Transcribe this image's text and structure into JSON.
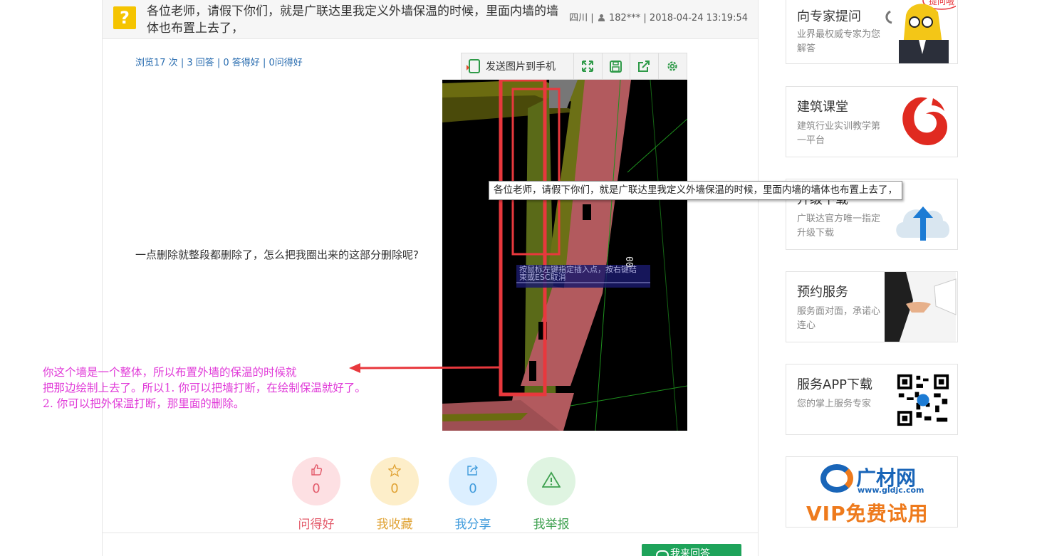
{
  "question": {
    "icon": "?",
    "title": "各位老师，请假下你们，就是广联达里我定义外墙保温的时候，里面内墙的墙体也布置上去了，",
    "region": "四川",
    "user": "182***",
    "time": "2018-04-24 13:19:54",
    "body": "一点删除就整段都删除了，怎么把我圈出来的这部分删除呢?"
  },
  "stats": {
    "views": "浏览17 次",
    "answers": "3 回答",
    "good_answers": "0 答得好",
    "good_questions": "0问得好",
    "sep": " | "
  },
  "image_toolbar": {
    "send_label": "发送图片到手机"
  },
  "cad_overlay": {
    "prompt_line1": "按鼠标左键指定插入点，按右键结",
    "prompt_line2": "束或ESC取消",
    "number": "00"
  },
  "tooltip": "各位老师，请假下你们，就是广联达里我定义外墙保温的时候，里面内墙的墙体也布置上去了，",
  "annotation": {
    "line1": "你这个墙是一个整体，所以布置外墙的保温的时候就",
    "line2": "把那边绘制上去了。所以1. 你可以把墙打断，在绘制保温就好了。",
    "line3": "2. 你可以把外保温打断，那里面的删除。"
  },
  "actions": [
    {
      "label": "问得好",
      "count": "0",
      "icon": "thumb-up-icon"
    },
    {
      "label": "我收藏",
      "count": "0",
      "icon": "star-icon"
    },
    {
      "label": "我分享",
      "count": "0",
      "icon": "share-icon"
    },
    {
      "label": "我举报",
      "count": "",
      "icon": "warning-icon"
    }
  ],
  "answer_button": "我来回答",
  "sidebar": [
    {
      "title": "向专家提问",
      "subtitle": "业界最权威专家为您解答",
      "bubble": "提问哦"
    },
    {
      "title": "建筑课堂",
      "subtitle": "建筑行业实训教学第一平台"
    },
    {
      "title": "升级下载",
      "subtitle": "广联达官方唯一指定升级下载"
    },
    {
      "title": "预约服务",
      "subtitle": "服务面对面，承诺心连心"
    },
    {
      "title": "服务APP下载",
      "subtitle": "您的掌上服务专家"
    }
  ],
  "banner": {
    "brand": "广材网",
    "url": "www.gldjc.com",
    "tagline": "VIP免费试用"
  },
  "colors": {
    "accent_green": "#1ea35a",
    "link_blue": "#2a6db0",
    "annotation_magenta": "#e03ad8",
    "annotation_red": "#e8383d"
  }
}
